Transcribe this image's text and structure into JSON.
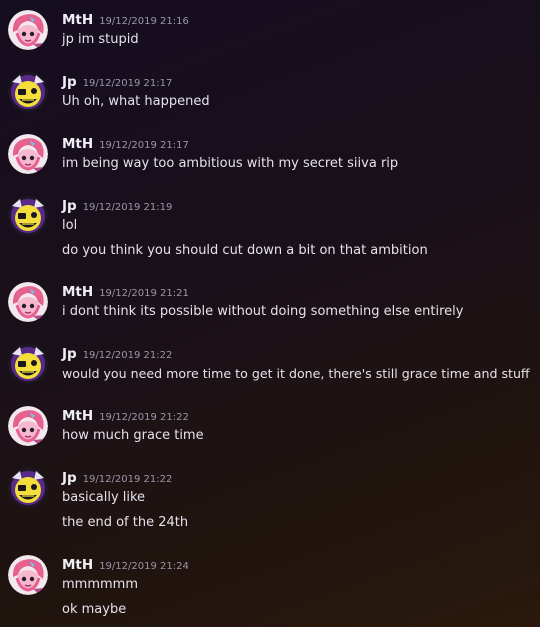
{
  "messages": [
    {
      "author": "MtH",
      "avatar": "mth-avatar-icon",
      "timestamp": "19/12/2019 21:16",
      "lines": [
        "jp im stupid"
      ]
    },
    {
      "author": "Jp",
      "avatar": "jp-avatar-icon",
      "timestamp": "19/12/2019 21:17",
      "lines": [
        "Uh oh, what happened"
      ]
    },
    {
      "author": "MtH",
      "avatar": "mth-avatar-icon",
      "timestamp": "19/12/2019 21:17",
      "lines": [
        "im being way too ambitious with my secret siiva rip"
      ]
    },
    {
      "author": "Jp",
      "avatar": "jp-avatar-icon",
      "timestamp": "19/12/2019 21:19",
      "lines": [
        "lol",
        "do you think you should cut down a bit on that ambition"
      ]
    },
    {
      "author": "MtH",
      "avatar": "mth-avatar-icon",
      "timestamp": "19/12/2019 21:21",
      "lines": [
        "i dont think its possible without doing something else entirely"
      ]
    },
    {
      "author": "Jp",
      "avatar": "jp-avatar-icon",
      "timestamp": "19/12/2019 21:22",
      "lines": [
        "would you need more time to get it done, there's still grace time and stuff"
      ]
    },
    {
      "author": "MtH",
      "avatar": "mth-avatar-icon",
      "timestamp": "19/12/2019 21:22",
      "lines": [
        "how much grace time"
      ]
    },
    {
      "author": "Jp",
      "avatar": "jp-avatar-icon",
      "timestamp": "19/12/2019 21:22",
      "lines": [
        "basically like",
        "the end of the 24th"
      ]
    },
    {
      "author": "MtH",
      "avatar": "mth-avatar-icon",
      "timestamp": "19/12/2019 21:24",
      "lines": [
        "mmmmmm",
        "ok maybe"
      ]
    }
  ],
  "colors": {
    "background_top": "#150d20",
    "background_bottom": "#2a190c",
    "username": "#f0eef5",
    "timestamp": "#9a96a8",
    "text": "#e4e2ea"
  }
}
